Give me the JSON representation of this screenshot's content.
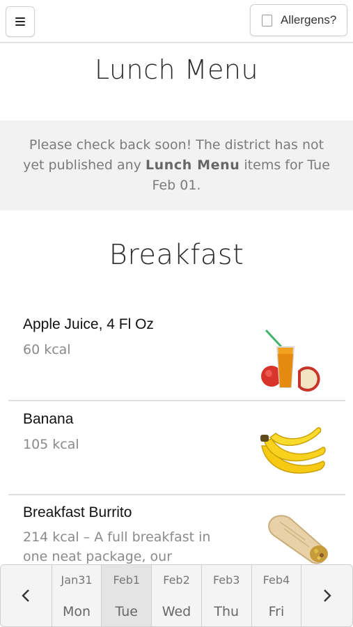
{
  "header": {
    "menu_icon": "hamburger-icon",
    "allergens_label": "Allergens?",
    "allergens_checked": false
  },
  "page_title": "Lunch Menu",
  "notice": {
    "before": "Please check back soon! The district has not yet published any ",
    "highlight": "Lunch Menu",
    "after": " items for Tue Feb 01."
  },
  "section": {
    "title": "Breakfast",
    "items": [
      {
        "name": "Apple Juice, 4 Fl Oz",
        "description": "60 kcal",
        "image_icon": "apple-juice-image"
      },
      {
        "name": "Banana",
        "description": "105 kcal",
        "image_icon": "banana-image"
      },
      {
        "name": "Breakfast Burrito",
        "description": "214 kcal – A full breakfast in one neat package, our",
        "image_icon": "burrito-image"
      }
    ]
  },
  "date_nav": {
    "prev_icon": "chevron-left-icon",
    "next_icon": "chevron-right-icon",
    "days": [
      {
        "date": "Jan31",
        "day": "Mon",
        "active": false
      },
      {
        "date": "Feb1",
        "day": "Tue",
        "active": true
      },
      {
        "date": "Feb2",
        "day": "Wed",
        "active": false
      },
      {
        "date": "Feb3",
        "day": "Thu",
        "active": false
      },
      {
        "date": "Feb4",
        "day": "Fri",
        "active": false
      }
    ]
  }
}
